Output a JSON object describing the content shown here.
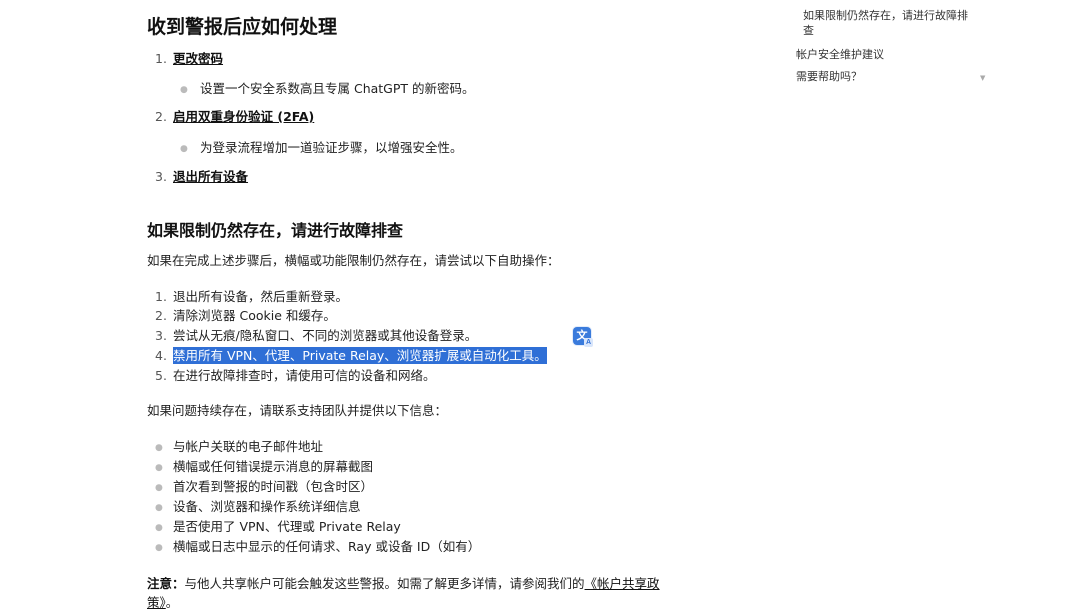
{
  "article": {
    "title": "收到警报后应如何处理",
    "actions": [
      {
        "num": "1.",
        "label": "更改密码",
        "detail": "设置一个安全系数高且专属 ChatGPT 的新密码。"
      },
      {
        "num": "2.",
        "label": "启用双重身份验证 (2FA)",
        "detail": "为登录流程增加一道验证步骤，以增强安全性。"
      },
      {
        "num": "3.",
        "label": "退出所有设备",
        "detail": ""
      }
    ],
    "troubleshoot": {
      "heading": "如果限制仍然存在，请进行故障排查",
      "intro": "如果在完成上述步骤后，横幅或功能限制仍然存在，请尝试以下自助操作：",
      "steps": [
        {
          "num": "1.",
          "text": "退出所有设备，然后重新登录。"
        },
        {
          "num": "2.",
          "text": "清除浏览器 Cookie 和缓存。"
        },
        {
          "num": "3.",
          "text": "尝试从无痕/隐私窗口、不同的浏览器或其他设备登录。"
        },
        {
          "num": "4.",
          "text": "禁用所有 VPN、代理、Private Relay、浏览器扩展或自动化工具。"
        },
        {
          "num": "5.",
          "text": "在进行故障排查时，请使用可信的设备和网络。"
        }
      ],
      "support_intro": "如果问题持续存在，请联系支持团队并提供以下信息：",
      "support_items": [
        "与帐户关联的电子邮件地址",
        "横幅或任何错误提示消息的屏幕截图",
        "首次看到警报的时间戳（包含时区）",
        "设备、浏览器和操作系统详细信息",
        "是否使用了 VPN、代理或 Private Relay",
        "横幅或日志中显示的任何请求、Ray 或设备 ID（如有）"
      ]
    },
    "note": {
      "label": "注意：",
      "text": "与他人共享帐户可能会触发这些警报。如需了解更多详情，请参阅我们的",
      "link": "《帐户共享政策》",
      "end": "。"
    }
  },
  "toc": {
    "items": [
      "如果限制仍然存在，请进行故障排查",
      "帐户安全维护建议",
      "需要帮助吗？"
    ]
  },
  "icons": {
    "translate": "translate-icon",
    "caret": "caret-down-icon"
  },
  "colors": {
    "selection": "#2f6fd6",
    "translate_button": "#3a7bdc"
  }
}
